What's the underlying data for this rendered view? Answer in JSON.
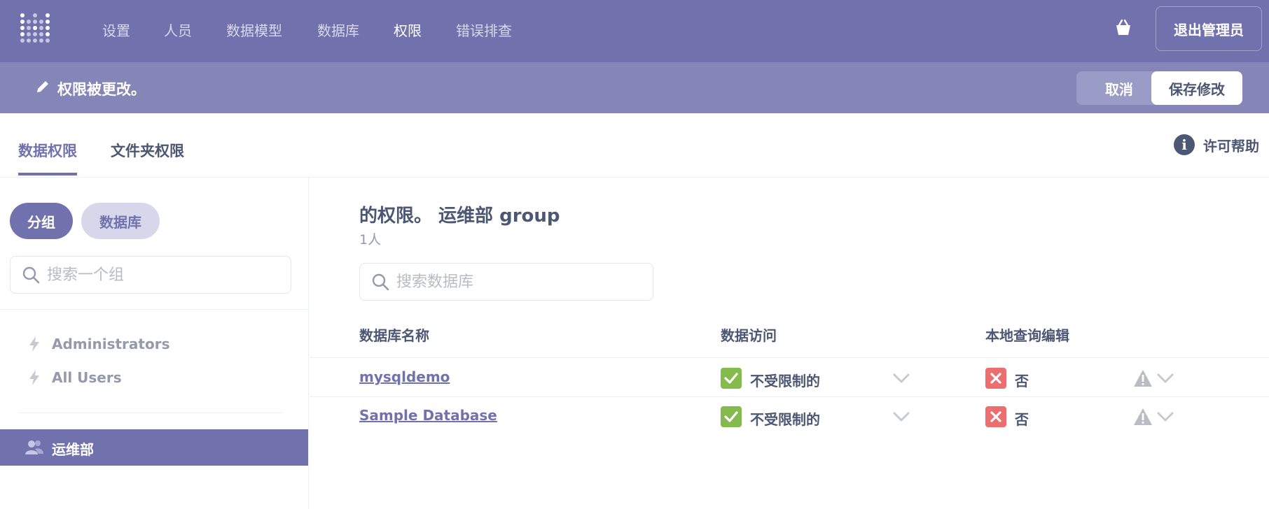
{
  "nav": {
    "items": [
      {
        "label": "设置"
      },
      {
        "label": "人员"
      },
      {
        "label": "数据模型"
      },
      {
        "label": "数据库"
      },
      {
        "label": "权限"
      },
      {
        "label": "错误排查"
      }
    ],
    "active": "权限",
    "exit_label": "退出管理员"
  },
  "editbar": {
    "message": "权限被更改。",
    "cancel_label": "取消",
    "save_label": "保存修改"
  },
  "tabs": [
    {
      "label": "数据权限"
    },
    {
      "label": "文件夹权限"
    }
  ],
  "active_tab": "数据权限",
  "help_label": "许可帮助",
  "sidebar": {
    "toggle": [
      {
        "label": "分组"
      },
      {
        "label": "数据库"
      }
    ],
    "search_placeholder": "搜索一个组",
    "groups": [
      {
        "label": "Administrators"
      },
      {
        "label": "All Users"
      }
    ],
    "active_group": "运维部"
  },
  "main": {
    "title": "的权限。 运维部 group",
    "subtitle": "1人",
    "search_placeholder": "搜索数据库",
    "columns": [
      "数据库名称",
      "数据访问",
      "本地查询编辑"
    ],
    "rows": [
      {
        "name": "mysqldemo",
        "access": "不受限制的",
        "native": "否"
      },
      {
        "name": "Sample Database",
        "access": "不受限制的",
        "native": "否"
      }
    ]
  },
  "colors": {
    "brand": "#7172ad",
    "editbar": "#8585b8",
    "success": "#84bb4c",
    "error": "#ed6e6e",
    "text": "#4c5773"
  }
}
